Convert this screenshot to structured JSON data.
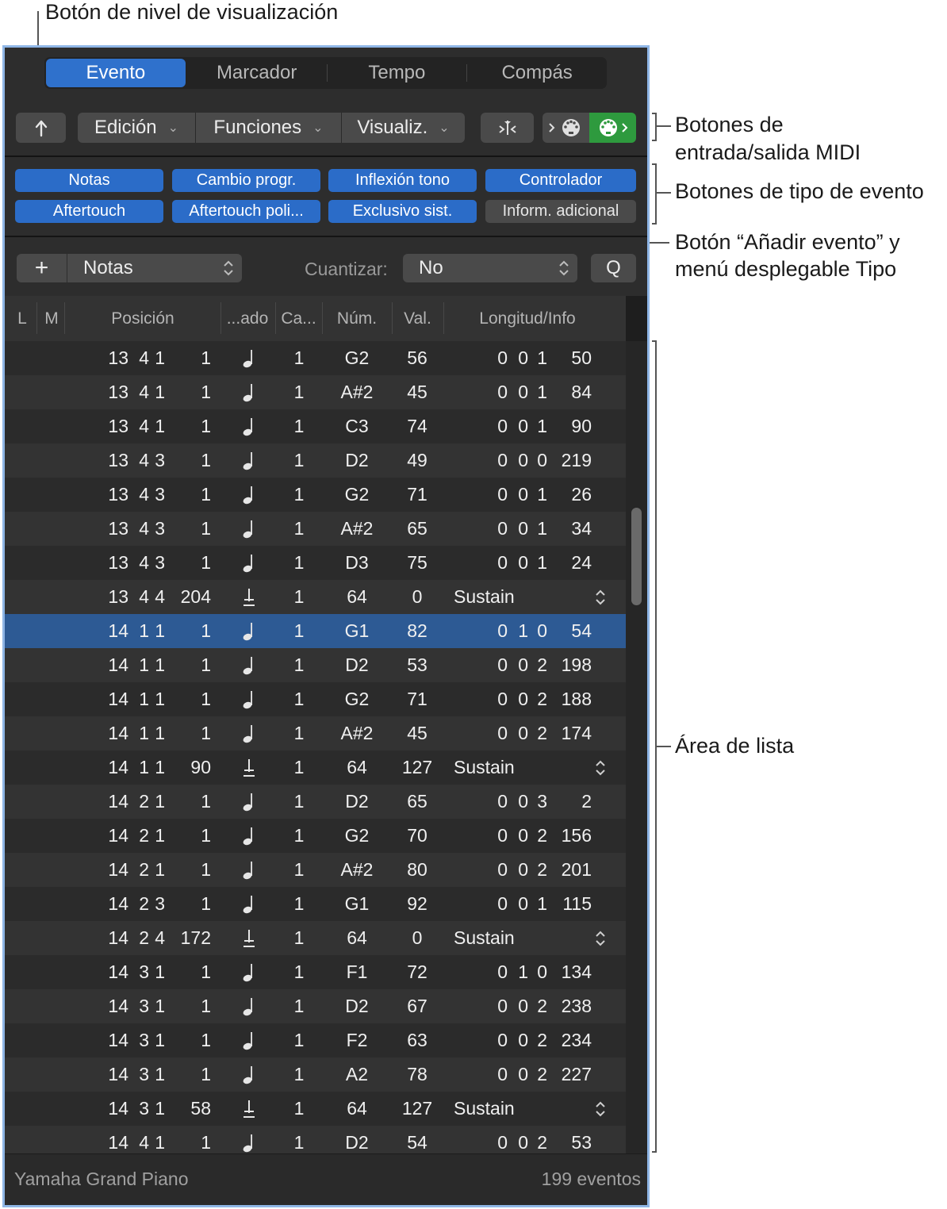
{
  "callouts": {
    "view_level": "Botón de nivel de visualización",
    "midi_io_line1": "Botones de",
    "midi_io_line2": "entrada/salida MIDI",
    "event_types": "Botones de tipo de evento",
    "add_event_line1": "Botón “Añadir evento” y",
    "add_event_line2": "menú desplegable Tipo",
    "list_area": "Área de lista"
  },
  "tabs": [
    "Evento",
    "Marcador",
    "Tempo",
    "Compás"
  ],
  "toolbar": {
    "edit_menu": "Edición",
    "functions_menu": "Funciones",
    "view_menu": "Visualiz."
  },
  "event_type_buttons": [
    {
      "label": "Notas",
      "on": true
    },
    {
      "label": "Cambio progr.",
      "on": true
    },
    {
      "label": "Inflexión tono",
      "on": true
    },
    {
      "label": "Controlador",
      "on": true
    },
    {
      "label": "Aftertouch",
      "on": true
    },
    {
      "label": "Aftertouch poli...",
      "on": true
    },
    {
      "label": "Exclusivo sist.",
      "on": true
    },
    {
      "label": "Inform. adicional",
      "on": false
    }
  ],
  "add_row": {
    "add_symbol": "+",
    "type_value": "Notas",
    "quantize_label": "Cuantizar:",
    "quantize_value": "No",
    "q_button": "Q"
  },
  "columns": {
    "l": "L",
    "m": "M",
    "position": "Posición",
    "status": "...ado",
    "channel": "Ca...",
    "number": "Núm.",
    "value": "Val.",
    "length": "Longitud/Info"
  },
  "rows": [
    {
      "pos": [
        "13",
        "4",
        "1",
        "1"
      ],
      "type": "note",
      "ch": "1",
      "num": "G2",
      "val": "56",
      "len": [
        "0",
        "0",
        "1",
        "50"
      ]
    },
    {
      "pos": [
        "13",
        "4",
        "1",
        "1"
      ],
      "type": "note",
      "ch": "1",
      "num": "A#2",
      "val": "45",
      "len": [
        "0",
        "0",
        "1",
        "84"
      ]
    },
    {
      "pos": [
        "13",
        "4",
        "1",
        "1"
      ],
      "type": "note",
      "ch": "1",
      "num": "C3",
      "val": "74",
      "len": [
        "0",
        "0",
        "1",
        "90"
      ]
    },
    {
      "pos": [
        "13",
        "4",
        "3",
        "1"
      ],
      "type": "note",
      "ch": "1",
      "num": "D2",
      "val": "49",
      "len": [
        "0",
        "0",
        "0",
        "219"
      ]
    },
    {
      "pos": [
        "13",
        "4",
        "3",
        "1"
      ],
      "type": "note",
      "ch": "1",
      "num": "G2",
      "val": "71",
      "len": [
        "0",
        "0",
        "1",
        "26"
      ]
    },
    {
      "pos": [
        "13",
        "4",
        "3",
        "1"
      ],
      "type": "note",
      "ch": "1",
      "num": "A#2",
      "val": "65",
      "len": [
        "0",
        "0",
        "1",
        "34"
      ]
    },
    {
      "pos": [
        "13",
        "4",
        "3",
        "1"
      ],
      "type": "note",
      "ch": "1",
      "num": "D3",
      "val": "75",
      "len": [
        "0",
        "0",
        "1",
        "24"
      ]
    },
    {
      "pos": [
        "13",
        "4",
        "4",
        "204"
      ],
      "type": "ctrl",
      "ch": "1",
      "num": "64",
      "val": "0",
      "info": "Sustain"
    },
    {
      "pos": [
        "14",
        "1",
        "1",
        "1"
      ],
      "type": "note",
      "ch": "1",
      "num": "G1",
      "val": "82",
      "len": [
        "0",
        "1",
        "0",
        "54"
      ],
      "selected": true
    },
    {
      "pos": [
        "14",
        "1",
        "1",
        "1"
      ],
      "type": "note",
      "ch": "1",
      "num": "D2",
      "val": "53",
      "len": [
        "0",
        "0",
        "2",
        "198"
      ]
    },
    {
      "pos": [
        "14",
        "1",
        "1",
        "1"
      ],
      "type": "note",
      "ch": "1",
      "num": "G2",
      "val": "71",
      "len": [
        "0",
        "0",
        "2",
        "188"
      ]
    },
    {
      "pos": [
        "14",
        "1",
        "1",
        "1"
      ],
      "type": "note",
      "ch": "1",
      "num": "A#2",
      "val": "45",
      "len": [
        "0",
        "0",
        "2",
        "174"
      ]
    },
    {
      "pos": [
        "14",
        "1",
        "1",
        "90"
      ],
      "type": "ctrl",
      "ch": "1",
      "num": "64",
      "val": "127",
      "info": "Sustain"
    },
    {
      "pos": [
        "14",
        "2",
        "1",
        "1"
      ],
      "type": "note",
      "ch": "1",
      "num": "D2",
      "val": "65",
      "len": [
        "0",
        "0",
        "3",
        "2"
      ]
    },
    {
      "pos": [
        "14",
        "2",
        "1",
        "1"
      ],
      "type": "note",
      "ch": "1",
      "num": "G2",
      "val": "70",
      "len": [
        "0",
        "0",
        "2",
        "156"
      ]
    },
    {
      "pos": [
        "14",
        "2",
        "1",
        "1"
      ],
      "type": "note",
      "ch": "1",
      "num": "A#2",
      "val": "80",
      "len": [
        "0",
        "0",
        "2",
        "201"
      ]
    },
    {
      "pos": [
        "14",
        "2",
        "3",
        "1"
      ],
      "type": "note",
      "ch": "1",
      "num": "G1",
      "val": "92",
      "len": [
        "0",
        "0",
        "1",
        "115"
      ]
    },
    {
      "pos": [
        "14",
        "2",
        "4",
        "172"
      ],
      "type": "ctrl",
      "ch": "1",
      "num": "64",
      "val": "0",
      "info": "Sustain"
    },
    {
      "pos": [
        "14",
        "3",
        "1",
        "1"
      ],
      "type": "note",
      "ch": "1",
      "num": "F1",
      "val": "72",
      "len": [
        "0",
        "1",
        "0",
        "134"
      ]
    },
    {
      "pos": [
        "14",
        "3",
        "1",
        "1"
      ],
      "type": "note",
      "ch": "1",
      "num": "D2",
      "val": "67",
      "len": [
        "0",
        "0",
        "2",
        "238"
      ]
    },
    {
      "pos": [
        "14",
        "3",
        "1",
        "1"
      ],
      "type": "note",
      "ch": "1",
      "num": "F2",
      "val": "63",
      "len": [
        "0",
        "0",
        "2",
        "234"
      ]
    },
    {
      "pos": [
        "14",
        "3",
        "1",
        "1"
      ],
      "type": "note",
      "ch": "1",
      "num": "A2",
      "val": "78",
      "len": [
        "0",
        "0",
        "2",
        "227"
      ]
    },
    {
      "pos": [
        "14",
        "3",
        "1",
        "58"
      ],
      "type": "ctrl",
      "ch": "1",
      "num": "64",
      "val": "127",
      "info": "Sustain"
    },
    {
      "pos": [
        "14",
        "4",
        "1",
        "1"
      ],
      "type": "note",
      "ch": "1",
      "num": "D2",
      "val": "54",
      "len": [
        "0",
        "0",
        "2",
        "53"
      ]
    }
  ],
  "scroll": {
    "thumb_start_fraction": 0.205,
    "thumb_size_fraction": 0.12
  },
  "footer": {
    "instrument": "Yamaha Grand Piano",
    "count": "199 eventos"
  },
  "colors": {
    "accent": "#2f71cc",
    "midi_out_active": "#2e9a3e",
    "selected_row": "#2d5a94"
  },
  "icons": {
    "view_level": "up-arrow-icon",
    "catch": "catch-playhead-icon",
    "midi_in": "midi-in-icon",
    "midi_out": "midi-out-icon",
    "note_type": "quarter-note-icon",
    "controller_type": "controller-icon"
  }
}
